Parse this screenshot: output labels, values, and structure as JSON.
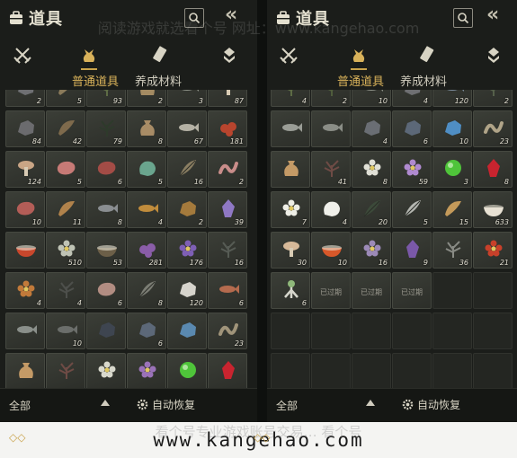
{
  "watermark_top": "阅读游戏就选看个号  网址：www.kangehao.com",
  "footer": {
    "url": "www.kangehao.com",
    "watermark": "看个号专业游戏账号交易…    看个号"
  },
  "colors": {
    "gold": "#d9b25a",
    "panel_bg": "#1b1d1a",
    "cell_bg": "#33362f"
  },
  "panels": [
    {
      "title": "道具",
      "category_icons": [
        "swords-icon",
        "pouch-icon",
        "scroll-icon",
        "gem-icon"
      ],
      "tabs": [
        {
          "label": "普通道具",
          "active": true
        },
        {
          "label": "养成材料",
          "active": false
        }
      ],
      "filter_label": "全部",
      "auto_restore_label": "自动恢复",
      "items": [
        {
          "qty": "2",
          "icon": "ore",
          "color": "#6e6f72"
        },
        {
          "qty": "5",
          "icon": "shell",
          "color": "#8a7a5a"
        },
        {
          "qty": "93",
          "icon": "herb",
          "color": "#5d6b45"
        },
        {
          "qty": "2",
          "icon": "sack",
          "color": "#a48b62"
        },
        {
          "qty": "3",
          "icon": "fish",
          "color": "#8c8f86"
        },
        {
          "qty": "87",
          "icon": "mushroom",
          "color": "#b88b5d"
        },
        {
          "qty": "84",
          "icon": "ore",
          "color": "#6b6b6e"
        },
        {
          "qty": "42",
          "icon": "shell",
          "color": "#7e6a4c"
        },
        {
          "qty": "79",
          "icon": "herb",
          "color": "#2e3a2b"
        },
        {
          "qty": "8",
          "icon": "sack",
          "color": "#a88c66"
        },
        {
          "qty": "67",
          "icon": "fish",
          "color": "#b4b1a4"
        },
        {
          "qty": "181",
          "icon": "berry",
          "color": "#b8452e"
        },
        {
          "qty": "124",
          "icon": "mushroom",
          "color": "#c9a585"
        },
        {
          "qty": "5",
          "icon": "meat",
          "color": "#c77a76"
        },
        {
          "qty": "6",
          "icon": "meat",
          "color": "#a34c46"
        },
        {
          "qty": "5",
          "icon": "jade",
          "color": "#6aa58e"
        },
        {
          "qty": "16",
          "icon": "feather",
          "color": "#8a7e62"
        },
        {
          "qty": "2",
          "icon": "worm",
          "color": "#c98d8a"
        },
        {
          "qty": "10",
          "icon": "meat",
          "color": "#b35d57"
        },
        {
          "qty": "11",
          "icon": "shell",
          "color": "#b0824b"
        },
        {
          "qty": "8",
          "icon": "fish",
          "color": "#8a8e91"
        },
        {
          "qty": "4",
          "icon": "fish",
          "color": "#c08c3c"
        },
        {
          "qty": "2",
          "icon": "ore",
          "color": "#a47a3c"
        },
        {
          "qty": "39",
          "icon": "crystal",
          "color": "#8f78c4"
        },
        {
          "qty": "",
          "icon": "bowl",
          "color": "#c8472c"
        },
        {
          "qty": "510",
          "icon": "flower",
          "color": "#bfc3b5"
        },
        {
          "qty": "53",
          "icon": "bowl",
          "color": "#6c5f48"
        },
        {
          "qty": "281",
          "icon": "berry",
          "color": "#8a5da8"
        },
        {
          "qty": "176",
          "icon": "flower",
          "color": "#7e5fb5"
        },
        {
          "qty": "16",
          "icon": "herb",
          "color": "#565b54"
        },
        {
          "qty": "4",
          "icon": "flower",
          "color": "#c27a3a"
        },
        {
          "qty": "4",
          "icon": "herb",
          "color": "#4d4f4b"
        },
        {
          "qty": "6",
          "icon": "meat",
          "color": "#b28d82"
        },
        {
          "qty": "8",
          "icon": "feather",
          "color": "#7b7d74"
        },
        {
          "qty": "120",
          "icon": "ore",
          "color": "#d6d4cc"
        },
        {
          "qty": "6",
          "icon": "fish",
          "color": "#b56b4e"
        },
        {
          "qty": "",
          "icon": "fish",
          "color": "#8a8f8a"
        },
        {
          "qty": "10",
          "icon": "fish",
          "color": "#6b6e6b"
        },
        {
          "qty": "",
          "icon": "ore",
          "color": "#3e4550"
        },
        {
          "qty": "6",
          "icon": "ore",
          "color": "#5c6878"
        },
        {
          "qty": "",
          "icon": "ore",
          "color": "#5a89b0"
        },
        {
          "qty": "23",
          "icon": "worm",
          "color": "#a0947a"
        },
        {
          "qty": "",
          "icon": "sack",
          "color": "#c49a66"
        },
        {
          "qty": "",
          "icon": "herb",
          "color": "#6e4b45"
        },
        {
          "qty": "",
          "icon": "flower",
          "color": "#d8d8cc"
        },
        {
          "qty": "",
          "icon": "flower",
          "color": "#9a72b8"
        },
        {
          "qty": "",
          "icon": "orb",
          "color": "#4fc43a"
        },
        {
          "qty": "",
          "icon": "crystal",
          "color": "#c8242f"
        }
      ]
    },
    {
      "title": "道具",
      "category_icons": [
        "swords-icon",
        "pouch-icon",
        "scroll-icon",
        "gem-icon"
      ],
      "tabs": [
        {
          "label": "普通道具",
          "active": true
        },
        {
          "label": "养成材料",
          "active": false
        }
      ],
      "filter_label": "全部",
      "auto_restore_label": "自动恢复",
      "items": [
        {
          "qty": "4",
          "icon": "herb",
          "color": "#5d6b45"
        },
        {
          "qty": "2",
          "icon": "herb",
          "color": "#4f5c3c"
        },
        {
          "qty": "10",
          "icon": "fish",
          "color": "#8c8f86"
        },
        {
          "qty": "4",
          "icon": "ore",
          "color": "#6e6f72"
        },
        {
          "qty": "120",
          "icon": "fish",
          "color": "#7a8a9a"
        },
        {
          "qty": "2",
          "icon": "herb",
          "color": "#55604a"
        },
        {
          "qty": "",
          "icon": "fish",
          "color": "#9a9d96"
        },
        {
          "qty": "",
          "icon": "fish",
          "color": "#8a8d86"
        },
        {
          "qty": "4",
          "icon": "ore",
          "color": "#6a6e74"
        },
        {
          "qty": "6",
          "icon": "ore",
          "color": "#5c6878"
        },
        {
          "qty": "10",
          "icon": "ore",
          "color": "#4f8ec4"
        },
        {
          "qty": "23",
          "icon": "worm",
          "color": "#b0a488"
        },
        {
          "qty": "",
          "icon": "sack",
          "color": "#c49a66"
        },
        {
          "qty": "41",
          "icon": "herb",
          "color": "#6e4b45"
        },
        {
          "qty": "8",
          "icon": "flower",
          "color": "#e0e0d6"
        },
        {
          "qty": "59",
          "icon": "flower",
          "color": "#b08ad0"
        },
        {
          "qty": "3",
          "icon": "orb",
          "color": "#4fc43a"
        },
        {
          "qty": "8",
          "icon": "crystal",
          "color": "#c8242f"
        },
        {
          "qty": "7",
          "icon": "flower",
          "color": "#eeeee6"
        },
        {
          "qty": "4",
          "icon": "jade",
          "color": "#f0f0ea"
        },
        {
          "qty": "20",
          "icon": "feather",
          "color": "#3c4a3a"
        },
        {
          "qty": "5",
          "icon": "feather",
          "color": "#b4b6b0"
        },
        {
          "qty": "15",
          "icon": "shell",
          "color": "#c49a5a"
        },
        {
          "qty": "633",
          "icon": "bowl",
          "color": "#e8e2d4"
        },
        {
          "qty": "30",
          "icon": "mushroom",
          "color": "#d6b898"
        },
        {
          "qty": "10",
          "icon": "bowl",
          "color": "#d8582a"
        },
        {
          "qty": "16",
          "icon": "flower",
          "color": "#9c8ab8"
        },
        {
          "qty": "9",
          "icon": "crystal",
          "color": "#7a58a8"
        },
        {
          "qty": "36",
          "icon": "herb",
          "color": "#888a84"
        },
        {
          "qty": "21",
          "icon": "flower",
          "color": "#c8402a"
        },
        {
          "qty": "6",
          "icon": "root",
          "color": "#d6d6cc"
        },
        {
          "qty": "",
          "icon": "expired",
          "color": "#3a3c38",
          "expired": "已过期"
        },
        {
          "qty": "",
          "icon": "expired",
          "color": "#3a3c38",
          "expired": "已过期"
        },
        {
          "qty": "",
          "icon": "expired",
          "color": "#3a3c38",
          "expired": "已过期"
        },
        {
          "qty": "",
          "icon": "empty",
          "color": ""
        },
        {
          "qty": "",
          "icon": "empty",
          "color": ""
        },
        {
          "qty": "",
          "icon": "empty",
          "color": ""
        },
        {
          "qty": "",
          "icon": "empty",
          "color": ""
        },
        {
          "qty": "",
          "icon": "empty",
          "color": ""
        },
        {
          "qty": "",
          "icon": "empty",
          "color": ""
        },
        {
          "qty": "",
          "icon": "empty",
          "color": ""
        },
        {
          "qty": "",
          "icon": "empty",
          "color": ""
        },
        {
          "qty": "",
          "icon": "empty",
          "color": ""
        },
        {
          "qty": "",
          "icon": "empty",
          "color": ""
        },
        {
          "qty": "",
          "icon": "empty",
          "color": ""
        },
        {
          "qty": "",
          "icon": "empty",
          "color": ""
        },
        {
          "qty": "",
          "icon": "empty",
          "color": ""
        },
        {
          "qty": "",
          "icon": "empty",
          "color": ""
        }
      ]
    }
  ]
}
